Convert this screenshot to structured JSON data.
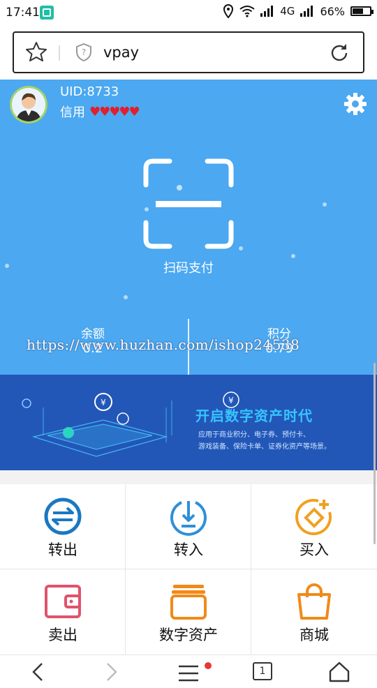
{
  "status_bar": {
    "time": "17:41",
    "network": "4G",
    "battery_text": "66%",
    "battery_level": 0.66
  },
  "browser": {
    "url": "vpay"
  },
  "profile": {
    "uid": "UID:8733",
    "credit_label": "信用",
    "credit_hearts": 5
  },
  "scan": {
    "label": "扫码支付"
  },
  "balance": {
    "label": "余额",
    "value": "0.2"
  },
  "points": {
    "label": "积分",
    "value": "0.79"
  },
  "watermark": "https://www.huzhan.com/ishop24538",
  "banner": {
    "title": "开启数字资产时代",
    "subtitle_line1": "应用于商业积分、电子券、预付卡、",
    "subtitle_line2": "游戏装备、保险卡单、证券化资产等场景。"
  },
  "actions": [
    {
      "label": "转出",
      "icon": "transfer-out-icon",
      "color": "#1a78c2"
    },
    {
      "label": "转入",
      "icon": "transfer-in-icon",
      "color": "#2f8fd8"
    },
    {
      "label": "买入",
      "icon": "buy-icon",
      "color": "#f0a020"
    },
    {
      "label": "卖出",
      "icon": "wallet-icon",
      "color": "#e0536a"
    },
    {
      "label": "数字资产",
      "icon": "digital-asset-icon",
      "color": "#f08a1a"
    },
    {
      "label": "商城",
      "icon": "shopping-bag-icon",
      "color": "#f08a1a"
    }
  ],
  "bottom_nav": {
    "tabs_count": "1"
  },
  "colors": {
    "hero_blue": "#4ba8f1",
    "banner_blue": "#2257b8",
    "heart_red": "#e21f2b"
  }
}
